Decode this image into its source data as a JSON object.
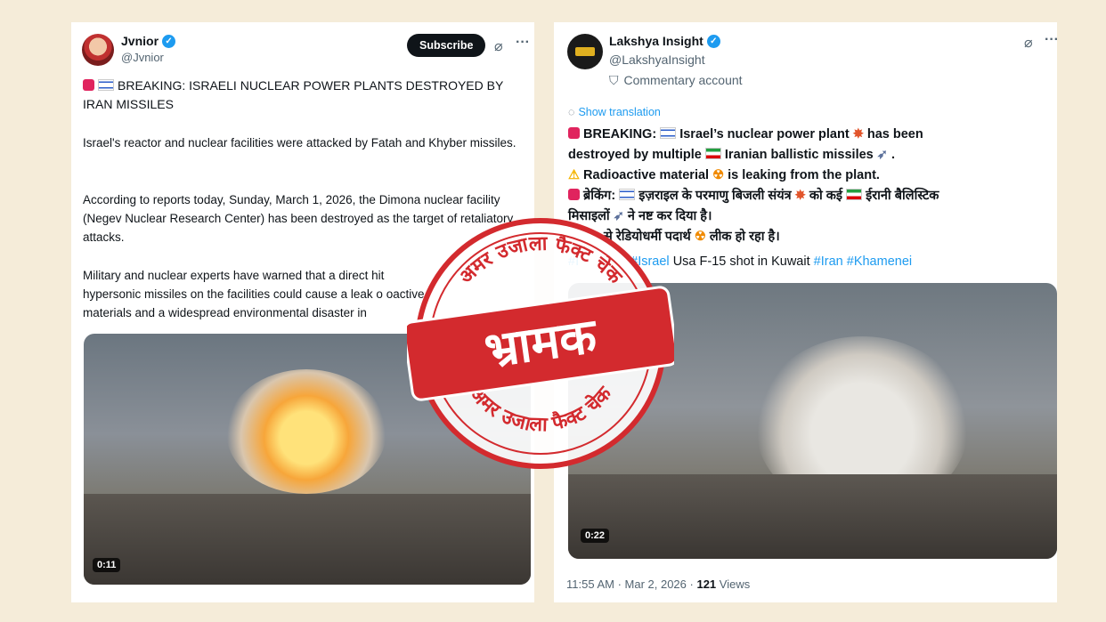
{
  "left": {
    "name": "Jvnior",
    "handle": "@Jvnior",
    "subscribe": "Subscribe",
    "headline": "BREAKING: ISRAELI NUCLEAR POWER PLANTS DESTROYED BY IRAN MISSILES",
    "p1": "Israel's reactor and nuclear facilities were attacked by Fatah and Khyber missiles.",
    "p2": "According to reports today, Sunday, March 1, 2026, the Dimona nuclear facility (Negev Nuclear Research Center) has been destroyed as the target of retaliatory attacks.",
    "p3a": "Military and nuclear experts have warned that a direct hit",
    "p3b": "hypersonic missiles on the facilities could cause a leak o",
    "p3b2": "oactive",
    "p3c": "materials and a widespread environmental disaster in",
    "duration": "0:11"
  },
  "right": {
    "name": "Lakshya Insight",
    "handle": "@LakshyaInsight",
    "commentary": "Commentary account",
    "show_translation": "Show translation",
    "l1a": "BREAKING:",
    "l1b": "Israel’s nuclear power plant",
    "l1c": "has been",
    "l2a": "destroyed by multiple",
    "l2b": "Iranian ballistic missiles",
    "l3": "Radioactive material",
    "l3b": "is leaking from the plant.",
    "l4a": "ब्रेकिंग:",
    "l4b": "इज़राइल के परमाणु बिजली संयंत्र",
    "l4c": "को कई",
    "l4d": "ईरानी बैलिस्टिक",
    "l5a": "मिसाइलों",
    "l5b": "ने नष्ट कर दिया है।",
    "l6a": "से रेडियोधर्मी पदार्थ",
    "l6b": "लीक हो रहा है।",
    "tags_a": "#I",
    "tags_b": "#Israel",
    "tags_c": "Usa F-15 shot in Kuwait",
    "tags_d": "#Iran",
    "tags_e": "#Khamenei",
    "duration": "0:22",
    "time": "11:55 AM · Mar 2, 2026 ·",
    "views_count": "121",
    "views_label": "Views"
  },
  "stamp": {
    "top_text": "अमर उजाला फैक्ट चेक",
    "main": "भ्रामक",
    "bottom_text": "अमर उजाला फैक्ट चेक",
    "color": "#d32a2e"
  }
}
